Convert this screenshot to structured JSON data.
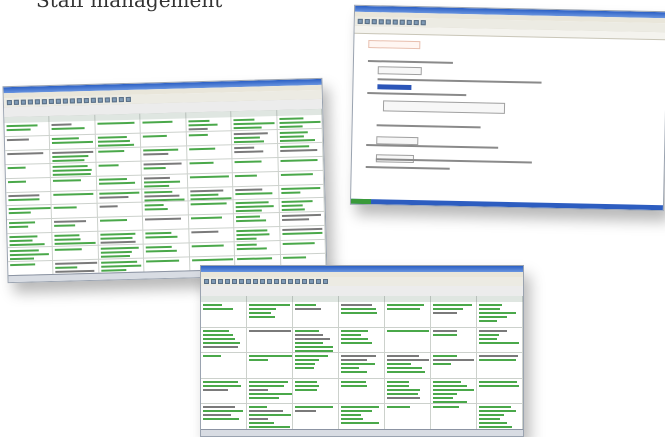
{
  "page": {
    "title": "Staff management"
  },
  "colors": {
    "accent_green": "#4aa84a",
    "titlebar_blue": "#2b5fc4",
    "highlight_blue": "#2b55b8",
    "form_title_red": "#c0392b"
  },
  "screens": [
    {
      "kind": "weekly-schedule-grid",
      "columns": 7,
      "rows": 11
    },
    {
      "kind": "questionnaire-form"
    },
    {
      "kind": "monthly-calendar",
      "columns": 7,
      "rows": 5
    }
  ]
}
